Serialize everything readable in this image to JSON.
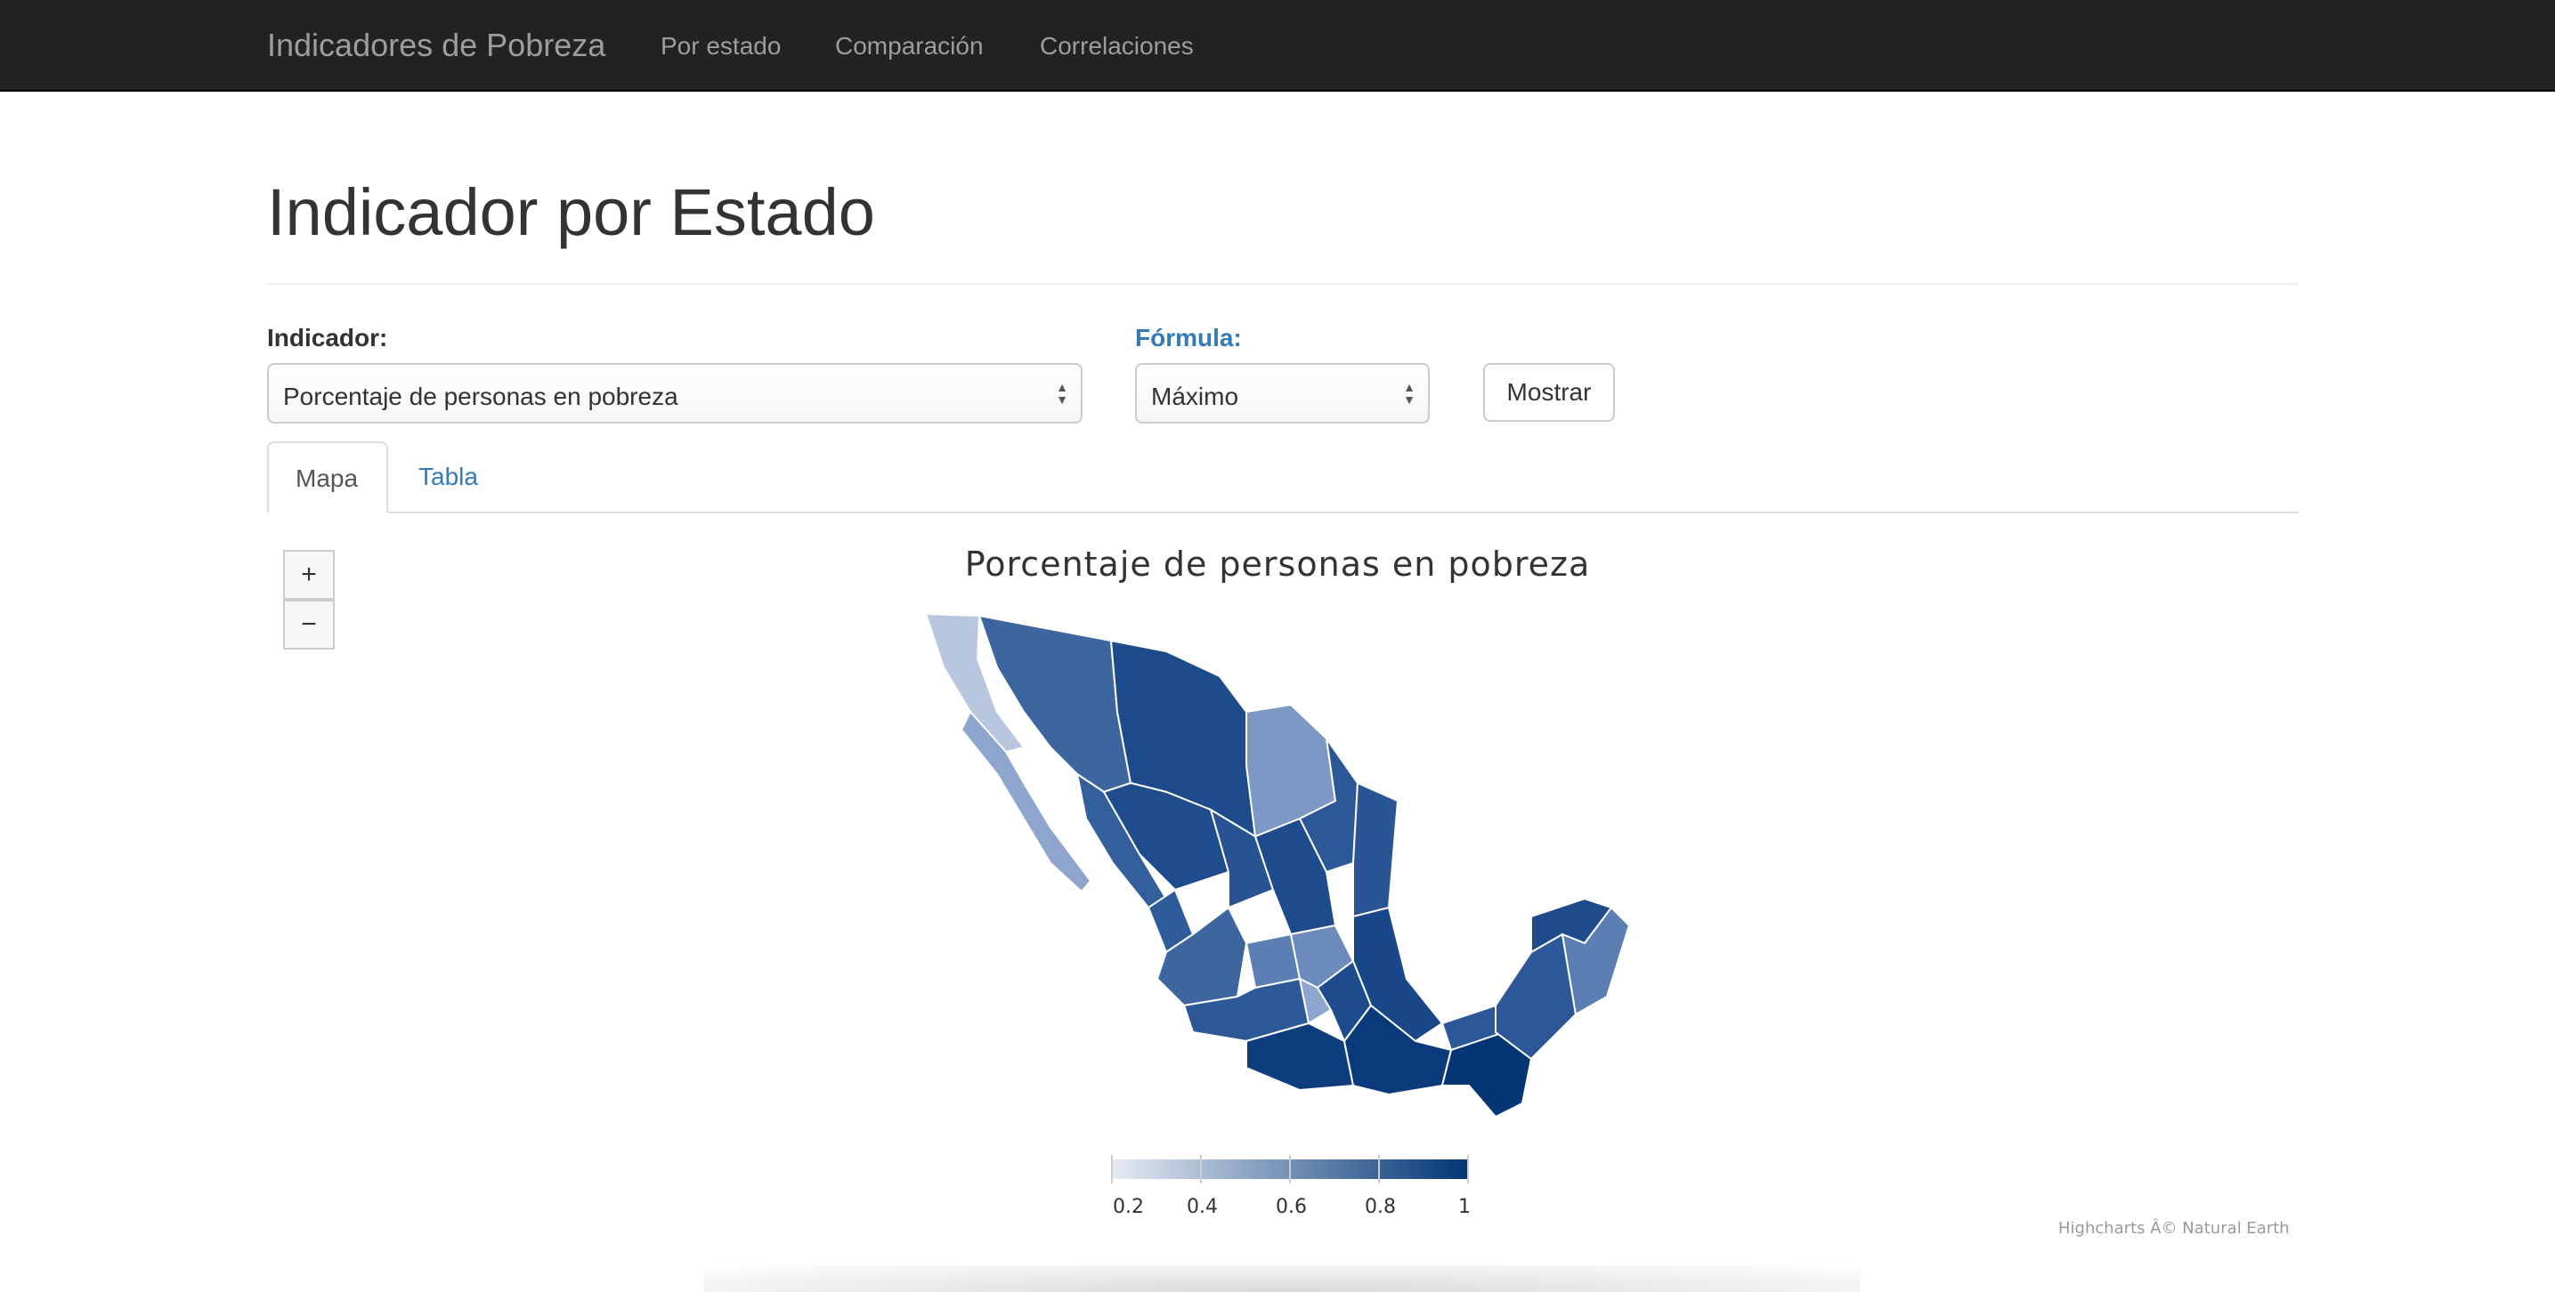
{
  "navbar": {
    "brand": "Indicadores de Pobreza",
    "links": [
      "Por estado",
      "Comparación",
      "Correlaciones"
    ]
  },
  "page": {
    "title": "Indicador por Estado"
  },
  "form": {
    "indicator_label": "Indicador:",
    "indicator_value": "Porcentaje de personas en pobreza",
    "formula_label": "Fórmula:",
    "formula_value": "Máximo",
    "submit_label": "Mostrar"
  },
  "tabs": [
    {
      "label": "Mapa",
      "active": true
    },
    {
      "label": "Tabla",
      "active": false
    }
  ],
  "map": {
    "zoom_in": "+",
    "zoom_out": "−",
    "title": "Porcentaje de personas en pobreza",
    "legend": {
      "labels": [
        "0.2",
        "0.4",
        "0.6",
        "0.8",
        "1"
      ],
      "color_min": "#e6ebf5",
      "color_max": "#003574"
    },
    "credits": "Highcharts Â© Natural Earth"
  },
  "colors": {
    "navbar_bg": "#222222",
    "link_blue": "#337ab7"
  }
}
